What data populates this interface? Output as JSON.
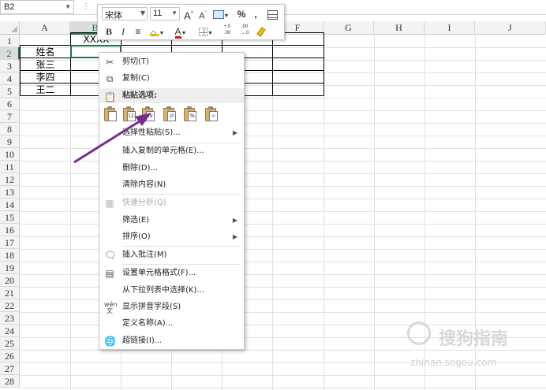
{
  "name_box": {
    "value": "B2"
  },
  "columns": [
    "A",
    "B",
    "C",
    "D",
    "E",
    "F",
    "G",
    "H",
    "I",
    "J"
  ],
  "rows": [
    "1",
    "2",
    "3",
    "4",
    "5",
    "6",
    "7",
    "8",
    "9",
    "10",
    "11",
    "12",
    "13",
    "14",
    "15",
    "16",
    "17",
    "18",
    "19",
    "20",
    "21",
    "22",
    "23",
    "24",
    "25",
    "26",
    "27",
    "28"
  ],
  "cells": {
    "b1": "XXXX",
    "a2": "姓名",
    "a3": "张三",
    "a4": "李四",
    "a5": "王二"
  },
  "mini_toolbar": {
    "font_name": "宋体",
    "font_size": "11",
    "grow_font": "A",
    "shrink_font": "A",
    "percent": "%",
    "comma": ",",
    "bold": "B",
    "italic": "I",
    "font_color_letter": "A",
    "inc_decimal": "+.0\n.00",
    "dec_decimal": ".00\n→.0"
  },
  "context_menu": {
    "cut": "剪切(T)",
    "copy": "复制(C)",
    "paste_options": "粘贴选项:",
    "paste_values_badge": "123",
    "paste_special": "选择性粘贴(S)...",
    "insert_copied": "插入复制的单元格(E)...",
    "delete": "删除(D)...",
    "clear": "清除内容(N)",
    "quick_analysis": "快速分析(Q)",
    "filter": "筛选(E)",
    "sort": "排序(O)",
    "insert_comment": "插入批注(M)",
    "format_cells": "设置单元格格式(F)...",
    "pick_from_list": "从下拉列表中选择(K)...",
    "phonetic": "显示拼音字段(S)",
    "define_name": "定义名称(A)...",
    "hyperlink": "超链接(I)..."
  },
  "colors": {
    "accent": "#217346",
    "arrow": "#7b2a8f"
  },
  "watermark": {
    "text": "搜狗指南",
    "url": "zhinan.sogou.com"
  }
}
